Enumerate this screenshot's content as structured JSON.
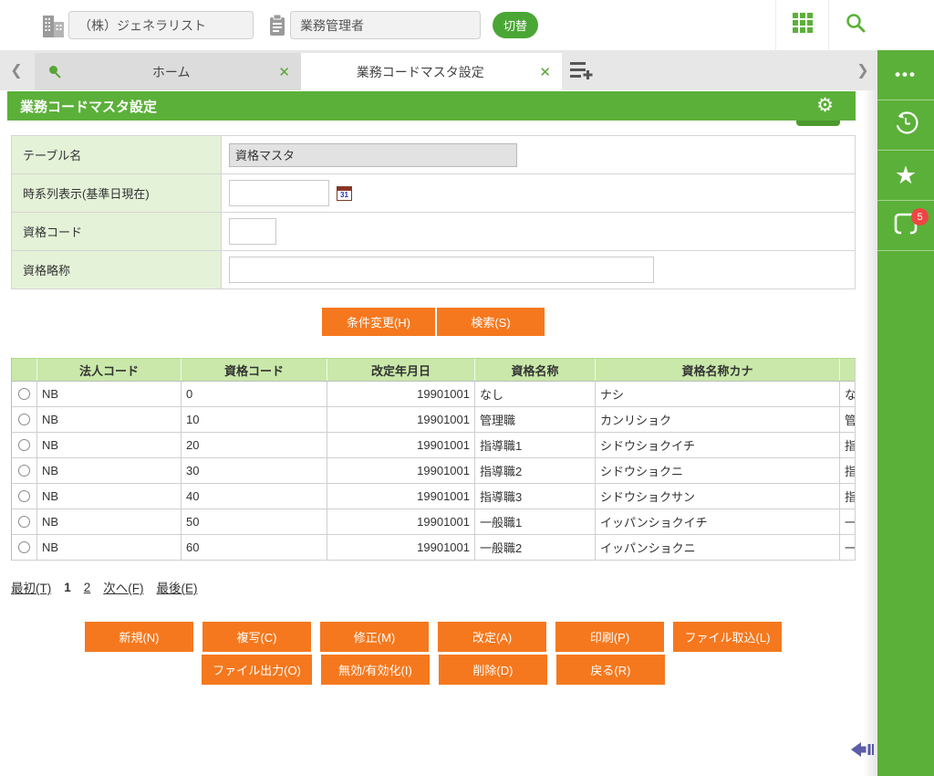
{
  "header": {
    "company_value": "（株）ジェネラリスト",
    "role_value": "業務管理者",
    "switch_button": "切替"
  },
  "tabs": {
    "home_label": "ホーム",
    "active_label": "業務コードマスタ設定",
    "close_glyph": "✕",
    "prev_glyph": "❮",
    "next_glyph": "❯"
  },
  "page": {
    "title": "業務コードマスタ設定"
  },
  "form": {
    "rows": [
      {
        "label": "テーブル名",
        "value": "資格マスタ"
      },
      {
        "label": "時系列表示(基準日現在)",
        "value": ""
      },
      {
        "label": "資格コード",
        "value": ""
      },
      {
        "label": "資格略称",
        "value": ""
      }
    ],
    "calendar_icon_text": "31"
  },
  "search_buttons": {
    "change": "条件変更(H)",
    "search": "検索(S)"
  },
  "table": {
    "headers": [
      "法人コード",
      "資格コード",
      "改定年月日",
      "資格名称",
      "資格名称カナ"
    ],
    "rows": [
      {
        "corp": "NB",
        "code": "0",
        "date": "19901001",
        "name": "なし",
        "kana": "ナシ",
        "cut": "な"
      },
      {
        "corp": "NB",
        "code": "10",
        "date": "19901001",
        "name": "管理職",
        "kana": "カンリショク",
        "cut": "管"
      },
      {
        "corp": "NB",
        "code": "20",
        "date": "19901001",
        "name": "指導職1",
        "kana": "シドウショクイチ",
        "cut": "指"
      },
      {
        "corp": "NB",
        "code": "30",
        "date": "19901001",
        "name": "指導職2",
        "kana": "シドウショクニ",
        "cut": "指"
      },
      {
        "corp": "NB",
        "code": "40",
        "date": "19901001",
        "name": "指導職3",
        "kana": "シドウショクサン",
        "cut": "指"
      },
      {
        "corp": "NB",
        "code": "50",
        "date": "19901001",
        "name": "一般職1",
        "kana": "イッパンショクイチ",
        "cut": "一"
      },
      {
        "corp": "NB",
        "code": "60",
        "date": "19901001",
        "name": "一般職2",
        "kana": "イッパンショクニ",
        "cut": "一"
      }
    ]
  },
  "pagination": {
    "first": "最初(T)",
    "page1": "1",
    "page2": "2",
    "next": "次へ(F)",
    "last": "最後(E)"
  },
  "actions": {
    "row1": [
      "新規(N)",
      "複写(C)",
      "修正(M)",
      "改定(A)",
      "印刷(P)",
      "ファイル取込(L)"
    ],
    "row2": [
      "ファイル出力(O)",
      "無効/有効化(I)",
      "削除(D)",
      "戻る(R)"
    ]
  },
  "sidebar": {
    "badge_count": "5",
    "more_glyph": "•••",
    "star_glyph": "★"
  },
  "icons": {
    "gear_glyph": "⚙"
  },
  "colors": {
    "accent_green": "#5bb039",
    "light_green": "#e4f2d8",
    "table_header_green": "#c9e8a9",
    "button_orange": "#f5781e",
    "badge_red": "#ef4545",
    "scroll_arrow_purple": "#5c5da8"
  }
}
